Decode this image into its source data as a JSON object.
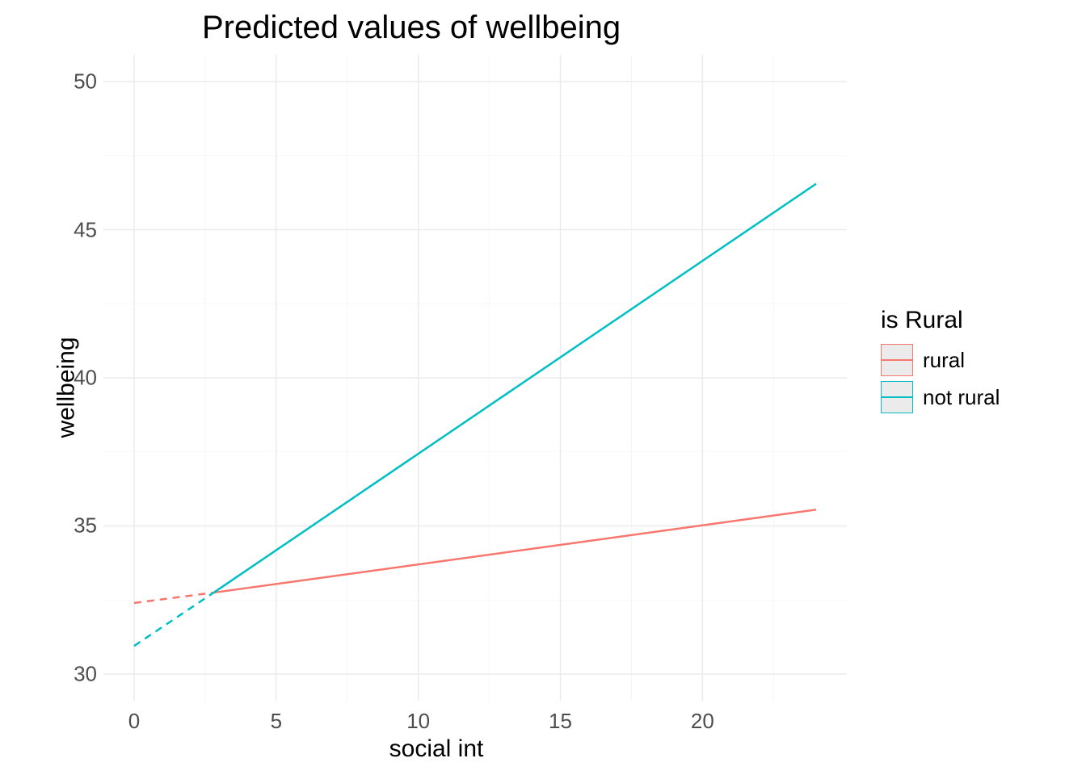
{
  "chart_data": {
    "type": "line",
    "title": "Predicted values of wellbeing",
    "xlabel": "social int",
    "ylabel": "wellbeing",
    "xlim": [
      0,
      24
    ],
    "ylim": [
      30,
      50
    ],
    "x_ticks": [
      0,
      5,
      10,
      15,
      20
    ],
    "y_ticks": [
      30,
      35,
      40,
      45,
      50
    ],
    "legend_title": "is Rural",
    "legend_position": "right",
    "series": [
      {
        "name": "rural",
        "color": "#f8766d",
        "segments": [
          {
            "style": "dashed",
            "points": [
              {
                "x": 0,
                "y": 32.4
              },
              {
                "x": 2.8,
                "y": 32.75
              }
            ]
          },
          {
            "style": "solid",
            "points": [
              {
                "x": 2.8,
                "y": 32.75
              },
              {
                "x": 24,
                "y": 35.55
              }
            ]
          }
        ]
      },
      {
        "name": "not rural",
        "color": "#00bfc4",
        "segments": [
          {
            "style": "dashed",
            "points": [
              {
                "x": 0,
                "y": 30.95
              },
              {
                "x": 2.8,
                "y": 32.75
              }
            ]
          },
          {
            "style": "solid",
            "points": [
              {
                "x": 2.8,
                "y": 32.75
              },
              {
                "x": 24,
                "y": 46.55
              }
            ]
          }
        ]
      }
    ]
  }
}
